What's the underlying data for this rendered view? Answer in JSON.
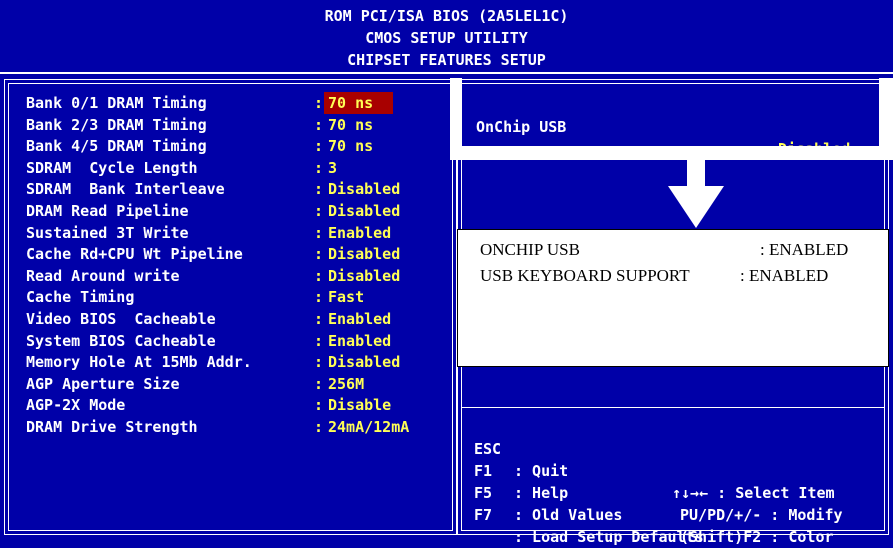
{
  "header": {
    "line1": "ROM PCI/ISA BIOS (2A5LEL1C)",
    "line2": "CMOS SETUP UTILITY",
    "line3": "CHIPSET FEATURES SETUP"
  },
  "colors": {
    "background": "#0000a8",
    "value": "#ffff55",
    "label": "#ffffff",
    "selected": "#a80000"
  },
  "settings": [
    {
      "label": "Bank 0/1 DRAM Timing",
      "value": "70 ns",
      "selected": true
    },
    {
      "label": "Bank 2/3 DRAM Timing",
      "value": "70 ns"
    },
    {
      "label": "Bank 4/5 DRAM Timing",
      "value": "70 ns"
    },
    {
      "label": "SDRAM  Cycle Length",
      "value": "3"
    },
    {
      "label": "SDRAM  Bank Interleave",
      "value": "Disabled"
    },
    {
      "label": "DRAM Read Pipeline",
      "value": "Disabled"
    },
    {
      "label": "Sustained 3T Write",
      "value": "Enabled"
    },
    {
      "label": "Cache Rd+CPU Wt Pipeline",
      "value": "Disabled"
    },
    {
      "label": "Read Around write",
      "value": "Disabled"
    },
    {
      "label": "Cache Timing",
      "value": "Fast"
    },
    {
      "label": "Video BIOS  Cacheable",
      "value": "Enabled"
    },
    {
      "label": "System BIOS Cacheable",
      "value": "Enabled"
    },
    {
      "label": "Memory Hole At 15Mb Addr.",
      "value": "Disabled"
    },
    {
      "label": "AGP Aperture Size",
      "value": "256M"
    },
    {
      "label": "AGP-2X Mode",
      "value": "Disable"
    },
    {
      "label": "DRAM Drive Strength",
      "value": "24mA/12mA"
    }
  ],
  "right_panel": {
    "onchip_label": "OnChip USB",
    "onchip_value": ": Disabled"
  },
  "callout": {
    "row1_label": "ONCHIP USB",
    "row1_value": ": ENABLED",
    "row2_label": "USB KEYBOARD SUPPORT",
    "row2_value": ": ENABLED"
  },
  "help": {
    "esc_key": "ESC",
    "esc_desc": ": Quit",
    "arrows": "↑↓→← : Select Item",
    "f1_key": "F1",
    "f1_desc": ": Help",
    "pu_pd": "PU/PD/+/- : Modify",
    "f5_key": "F5",
    "f5_desc": ": Old Values",
    "shift_f2": "(Shift)F2 : Color",
    "f7_key": "F7",
    "f7_desc": ": Load Setup Defaults"
  }
}
